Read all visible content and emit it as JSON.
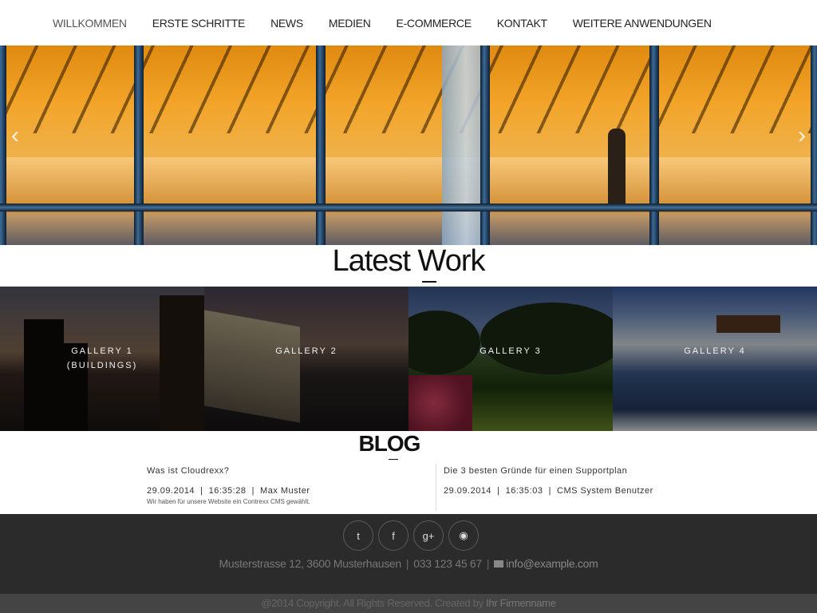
{
  "nav": {
    "items": [
      {
        "label": "WILLKOMMEN"
      },
      {
        "label": "ERSTE SCHRITTE"
      },
      {
        "label": "NEWS"
      },
      {
        "label": "MEDIEN"
      },
      {
        "label": "E-COMMERCE"
      },
      {
        "label": "KONTAKT"
      },
      {
        "label": "WEITERE ANWENDUNGEN"
      }
    ],
    "active_index": 0
  },
  "hero": {
    "prev_label": "‹",
    "next_label": "›"
  },
  "latest_work": {
    "title": "Latest Work",
    "galleries": [
      {
        "line1": "GALLERY 1",
        "line2": "(BUILDINGS)"
      },
      {
        "line1": "GALLERY 2",
        "line2": ""
      },
      {
        "line1": "GALLERY 3",
        "line2": ""
      },
      {
        "line1": "GALLERY 4",
        "line2": ""
      }
    ]
  },
  "blog": {
    "title": "BLOG",
    "posts": [
      {
        "title": "Was ist Cloudrexx?",
        "meta": "29.09.2014  |  16:35:28  |  Max Muster",
        "excerpt": "Wir haben für unsere Website ein Contrexx CMS gewählt."
      },
      {
        "title": "Die 3 besten Gründe für einen Supportplan",
        "meta": "29.09.2014  |  16:35:03  |  CMS System Benutzer",
        "excerpt": ""
      }
    ]
  },
  "footer": {
    "social": [
      {
        "icon": "twitter-icon",
        "glyph": "t"
      },
      {
        "icon": "facebook-icon",
        "glyph": "f"
      },
      {
        "icon": "google-plus-icon",
        "glyph": "g+"
      },
      {
        "icon": "rss-icon",
        "glyph": "◉"
      }
    ],
    "address": "Musterstrasse 12, 3600 Musterhausen",
    "phone": "033 123 45 67",
    "email": "info@example.com",
    "copyright": "@2014 Copyright. All Rights Reserved. Created by",
    "company": "Ihr Firmenname"
  }
}
